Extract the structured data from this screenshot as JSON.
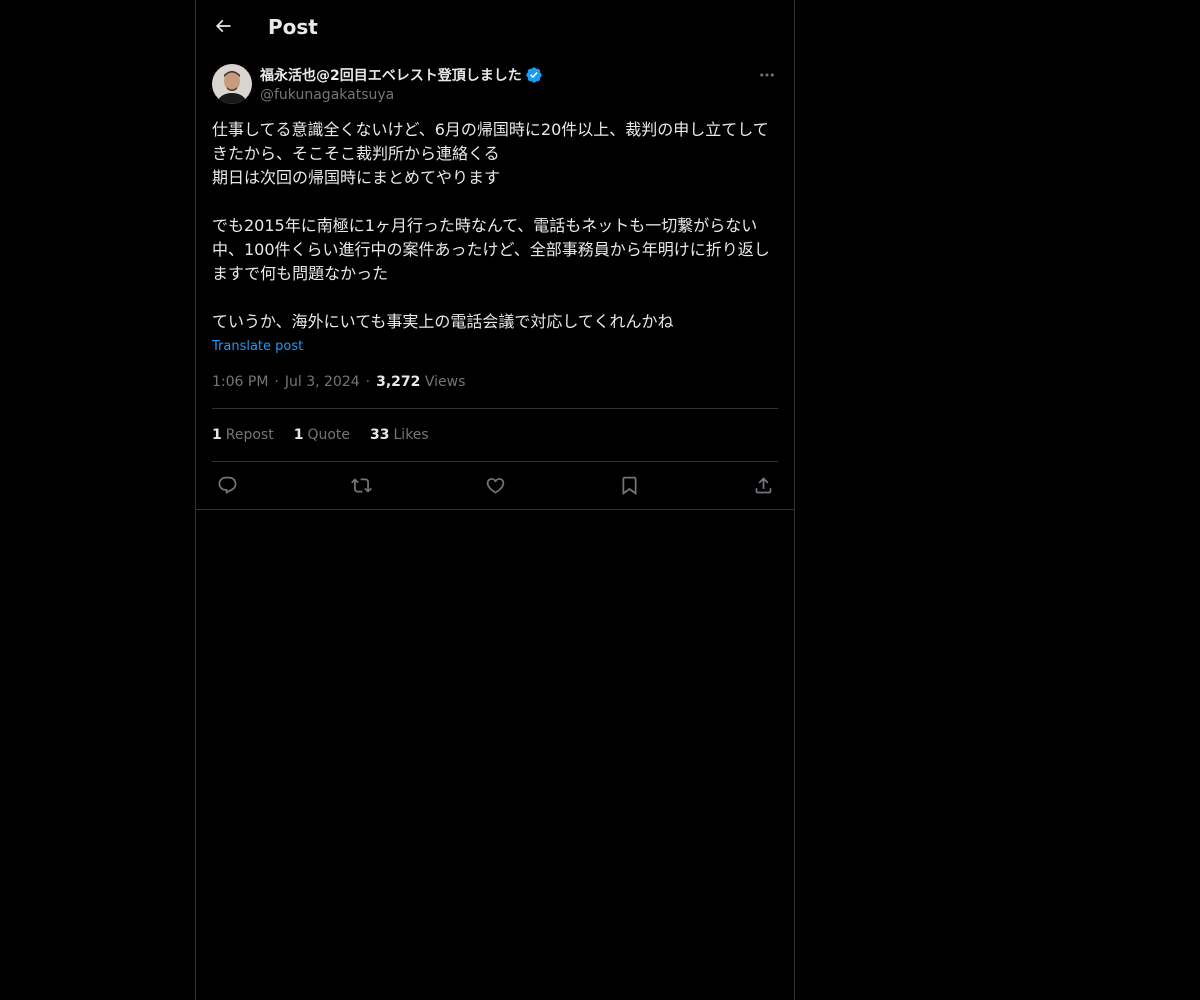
{
  "header": {
    "title": "Post"
  },
  "post": {
    "author": {
      "display_name": "福永活也@2回目エベレスト登頂しました",
      "handle": "@fukunagakatsuya",
      "verified": true
    },
    "text": "仕事してる意識全くないけど、6月の帰国時に20件以上、裁判の申し立てしてきたから、そこそこ裁判所から連絡くる\n期日は次回の帰国時にまとめてやります\n\nでも2015年に南極に1ヶ月行った時なんて、電話もネットも一切繋がらない中、100件くらい進行中の案件あったけど、全部事務員から年明けに折り返しますで何も問題なかった\n\nていうか、海外にいても事実上の電話会議で対応してくれんかね",
    "translate_label": "Translate post",
    "time": "1:06 PM",
    "date": "Jul 3, 2024",
    "meta_sep": "·",
    "views_count": "3,272",
    "views_label": "Views",
    "stats": {
      "reposts_count": "1",
      "reposts_label": "Repost",
      "quotes_count": "1",
      "quotes_label": "Quote",
      "likes_count": "33",
      "likes_label": "Likes"
    }
  },
  "icons": {
    "back": "arrow-left-icon",
    "verified": "verified-badge-icon",
    "more": "more-horizontal-icon",
    "reply": "reply-icon",
    "repost": "repost-icon",
    "like": "heart-icon",
    "bookmark": "bookmark-icon",
    "share": "share-icon"
  },
  "colors": {
    "background": "#000000",
    "text_primary": "#e7e9ea",
    "text_secondary": "#71767b",
    "accent": "#1d9bf0",
    "border": "#2f3336"
  }
}
